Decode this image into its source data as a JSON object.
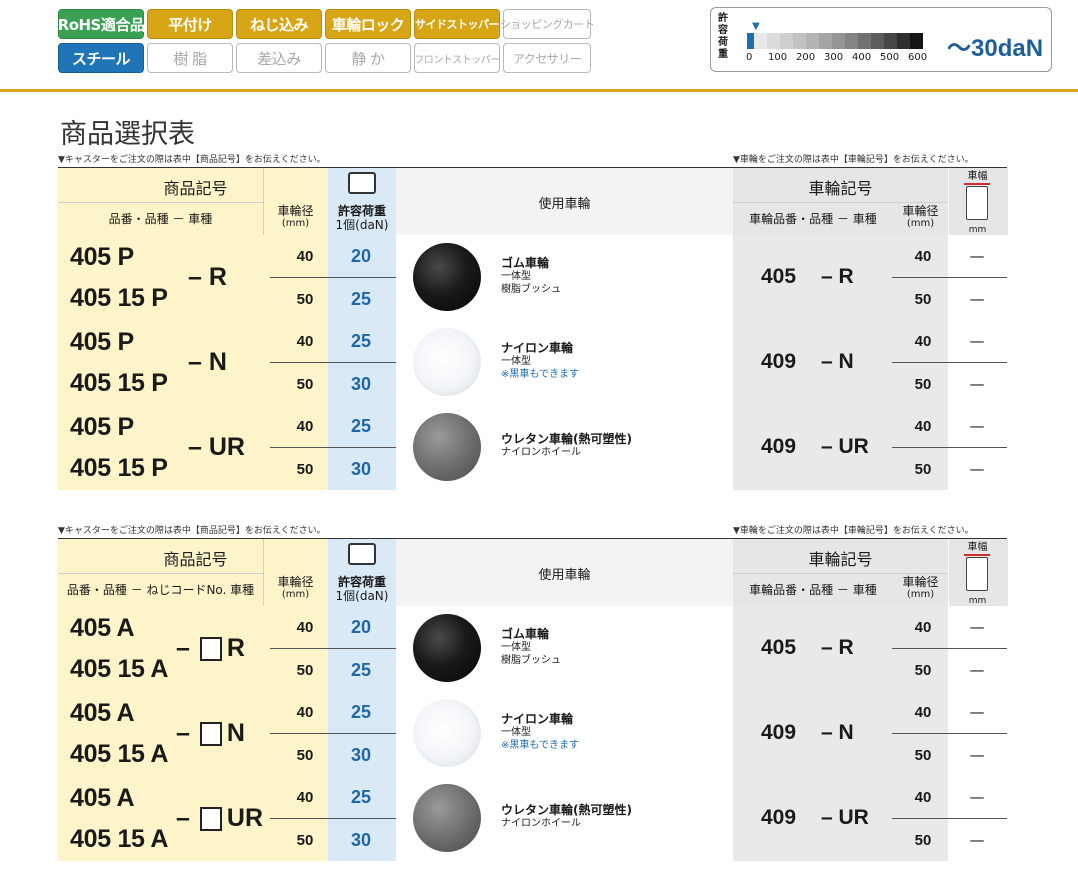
{
  "badges": {
    "row1": [
      "RoHS適合品",
      "平付け",
      "ねじ込み",
      "車輪ロック",
      "サイドストッパー",
      "ショッピングカート"
    ],
    "row2": [
      "スチール",
      "樹 脂",
      "差込み",
      "静 か",
      "フロントストッパー",
      "アクセサリー"
    ]
  },
  "load": {
    "label": [
      "許",
      "容",
      "荷",
      "重"
    ],
    "ticks": [
      "0",
      "100",
      "200",
      "300",
      "400",
      "500",
      "600"
    ],
    "value": "～30daN",
    "marker": "▼",
    "level_dan": 30,
    "colors": [
      "#1f6fb0",
      "#e8e8e8",
      "#dcdcdc",
      "#cfcfcf",
      "#c2c2c2",
      "#b4b4b4",
      "#a5a5a5",
      "#959595",
      "#848484",
      "#717171",
      "#5d5d5d",
      "#474747",
      "#2f2f2f",
      "#151515"
    ]
  },
  "title": "商品選択表",
  "tables": [
    {
      "note_left": "▼キャスターをご注文の際は表中【商品記号】をお伝えください。",
      "note_right": "▼車輪をご注文の際は表中【車輪記号】をお伝えください。",
      "header": {
        "product_code": "商品記号",
        "product_sub": "品番・品種 － 車種",
        "diameter": "車輪径",
        "diameter_unit": "(mm)",
        "load": "許容荷重",
        "load_unit": "1個(daN)",
        "wheel_used": "使用車輪",
        "wheel_code": "車輪記号",
        "wheel_sub": "車輪品番・品種 － 車種",
        "wheel_dia": "車輪径",
        "wheel_dia_unit": "(mm)",
        "width": "車幅",
        "width_unit": "mm"
      },
      "rows": [
        {
          "p1": "405 P",
          "p2": "405 15 P",
          "type": "– R",
          "d1": "40",
          "d2": "50",
          "l1": "20",
          "l2": "25",
          "wheel": "rubber",
          "wname": "ゴム車輪",
          "ws1": "一体型",
          "ws2": "樹脂ブッシュ",
          "ws2_blue": false,
          "wnum": "405",
          "wtype": "– R",
          "wd1": "40",
          "wd2": "50",
          "w1": "—",
          "w2": "—"
        },
        {
          "p1": "405 P",
          "p2": "405 15 P",
          "type": "– N",
          "d1": "40",
          "d2": "50",
          "l1": "25",
          "l2": "30",
          "wheel": "nylon",
          "wname": "ナイロン車輪",
          "ws1": "一体型",
          "ws2": "※黒車もできます",
          "ws2_blue": true,
          "wnum": "409",
          "wtype": "– N",
          "wd1": "40",
          "wd2": "50",
          "w1": "—",
          "w2": "—"
        },
        {
          "p1": "405 P",
          "p2": "405 15 P",
          "type": "– UR",
          "d1": "40",
          "d2": "50",
          "l1": "25",
          "l2": "30",
          "wheel": "urethane",
          "wname": "ウレタン車輪(熱可塑性)",
          "ws1": "ナイロンホイール",
          "ws2": "",
          "ws2_blue": false,
          "wnum": "409",
          "wtype": "– UR",
          "wd1": "40",
          "wd2": "50",
          "w1": "—",
          "w2": "—"
        }
      ]
    },
    {
      "note_left": "▼キャスターをご注文の際は表中【商品記号】をお伝えください。",
      "note_right": "▼車輪をご注文の際は表中【車輪記号】をお伝えください。",
      "header": {
        "product_code": "商品記号",
        "product_sub": "品番・品種 － ねじコードNo. 車種",
        "diameter": "車輪径",
        "diameter_unit": "(mm)",
        "load": "許容荷重",
        "load_unit": "1個(daN)",
        "wheel_used": "使用車輪",
        "wheel_code": "車輪記号",
        "wheel_sub": "車輪品番・品種 － 車種",
        "wheel_dia": "車輪径",
        "wheel_dia_unit": "(mm)",
        "width": "車幅",
        "width_unit": "mm"
      },
      "rows": [
        {
          "p1": "405 A",
          "p2": "405 15 A",
          "type_pre": "–",
          "type": "R",
          "d1": "40",
          "d2": "50",
          "l1": "20",
          "l2": "25",
          "wheel": "rubber",
          "wname": "ゴム車輪",
          "ws1": "一体型",
          "ws2": "樹脂ブッシュ",
          "ws2_blue": false,
          "wnum": "405",
          "wtype": "– R",
          "wd1": "40",
          "wd2": "50",
          "w1": "—",
          "w2": "—"
        },
        {
          "p1": "405 A",
          "p2": "405 15 A",
          "type_pre": "–",
          "type": "N",
          "d1": "40",
          "d2": "50",
          "l1": "25",
          "l2": "30",
          "wheel": "nylon",
          "wname": "ナイロン車輪",
          "ws1": "一体型",
          "ws2": "※黒車もできます",
          "ws2_blue": true,
          "wnum": "409",
          "wtype": "– N",
          "wd1": "40",
          "wd2": "50",
          "w1": "—",
          "w2": "—"
        },
        {
          "p1": "405 A",
          "p2": "405 15 A",
          "type_pre": "–",
          "type": "UR",
          "d1": "40",
          "d2": "50",
          "l1": "25",
          "l2": "30",
          "wheel": "urethane",
          "wname": "ウレタン車輪(熱可塑性)",
          "ws1": "ナイロンホイール",
          "ws2": "",
          "ws2_blue": false,
          "wnum": "409",
          "wtype": "– UR",
          "wd1": "40",
          "wd2": "50",
          "w1": "—",
          "w2": "—"
        }
      ]
    }
  ]
}
